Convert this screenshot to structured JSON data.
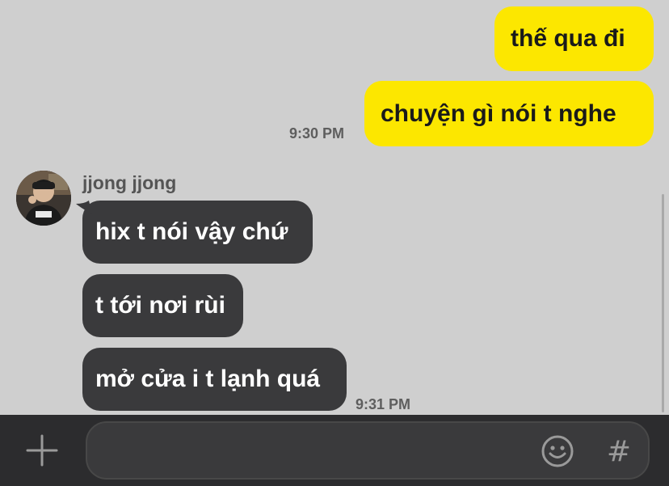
{
  "colors": {
    "background": "#cfcfcf",
    "outgoing_bubble": "#fce700",
    "incoming_bubble": "#3a3a3c",
    "input_bar": "#2c2c2e"
  },
  "messages": {
    "outgoing": [
      {
        "text": "thế qua đi"
      },
      {
        "text": "chuyện gì nói t nghe"
      }
    ],
    "outgoing_time": "9:30 PM",
    "sender_name": "jjong jjong",
    "incoming": [
      {
        "text": "hix t nói vậy chứ"
      },
      {
        "text": "t tới nơi rùi"
      },
      {
        "text": "mở cửa i t lạnh quá"
      }
    ],
    "incoming_time": "9:31 PM"
  },
  "composer": {
    "value": "",
    "plus_icon": "plus-icon",
    "emoji_icon": "emoji-icon",
    "hash_label": "#"
  }
}
